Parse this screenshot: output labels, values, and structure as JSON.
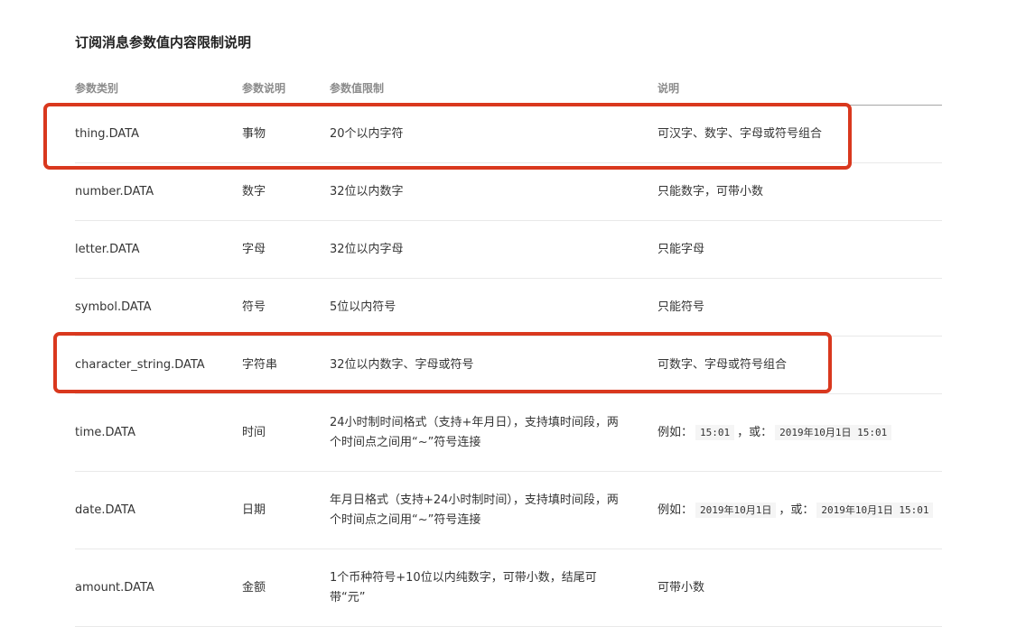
{
  "title": "订阅消息参数值内容限制说明",
  "headers": [
    "参数类别",
    "参数说明",
    "参数值限制",
    "说明"
  ],
  "rows": [
    {
      "category": "thing.DATA",
      "desc": "事物",
      "limit": "20个以内字符",
      "note": "可汉字、数字、字母或符号组合"
    },
    {
      "category": "number.DATA",
      "desc": "数字",
      "limit": "32位以内数字",
      "note": "只能数字，可带小数"
    },
    {
      "category": "letter.DATA",
      "desc": "字母",
      "limit": "32位以内字母",
      "note": "只能字母"
    },
    {
      "category": "symbol.DATA",
      "desc": "符号",
      "limit": "5位以内符号",
      "note": "只能符号"
    },
    {
      "category": "character_string.DATA",
      "desc": "字符串",
      "limit": "32位以内数字、字母或符号",
      "note": "可数字、字母或符号组合"
    },
    {
      "category": "time.DATA",
      "desc": "时间",
      "limit": "24小时制时间格式（支持+年月日），支持填时间段，两个时间点之间用“~”符号连接",
      "note_prefix": "例如：",
      "note_code1": "15:01",
      "note_sep": "，或：",
      "note_code2": "2019年10月1日 15:01"
    },
    {
      "category": "date.DATA",
      "desc": "日期",
      "limit": "年月日格式（支持+24小时制时间），支持填时间段，两个时间点之间用“~”符号连接",
      "note_prefix": "例如：",
      "note_code1": "2019年10月1日",
      "note_sep": "，或：",
      "note_code2": "2019年10月1日 15:01"
    },
    {
      "category": "amount.DATA",
      "desc": "金额",
      "limit": "1个币种符号+10位以内纯数字，可带小数，结尾可带“元”",
      "note": "可带小数"
    }
  ],
  "highlight_color": "#d9381e"
}
